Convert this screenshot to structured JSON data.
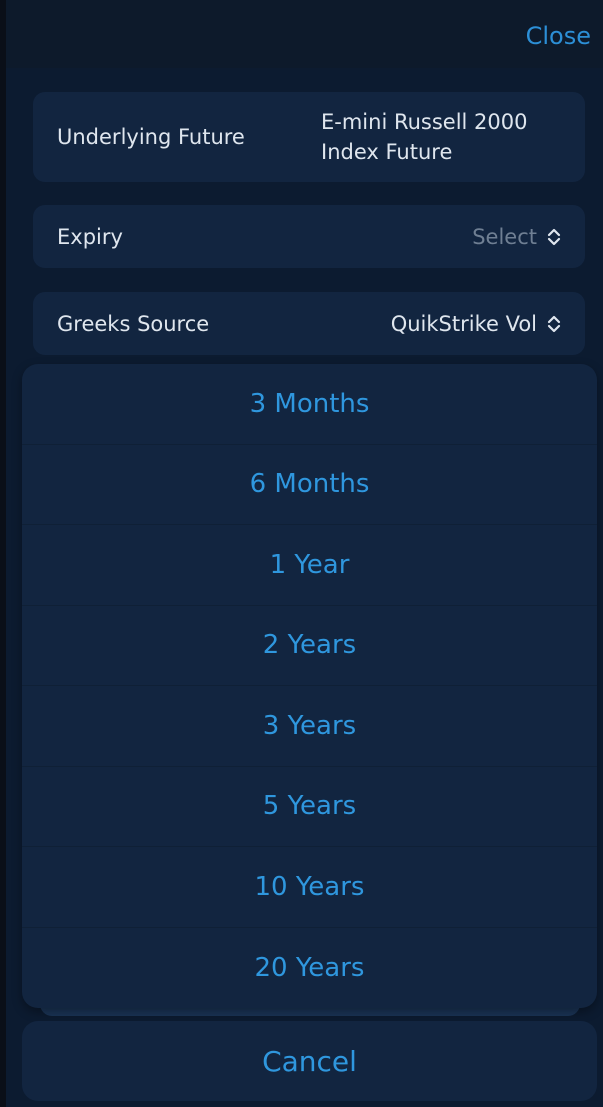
{
  "header": {
    "close_label": "Close"
  },
  "form": {
    "underlying": {
      "label": "Underlying Future",
      "value": "E-mini Russell 2000 Index Future"
    },
    "expiry": {
      "label": "Expiry",
      "value": "Select"
    },
    "greeks": {
      "label": "Greeks Source",
      "value": "QuikStrike Vol"
    }
  },
  "picker": {
    "options": [
      "3 Months",
      "6 Months",
      "1 Year",
      "2 Years",
      "3 Years",
      "5 Years",
      "10 Years",
      "20 Years"
    ]
  },
  "cancel_label": "Cancel",
  "colors": {
    "accent": "#2f97de",
    "card": "#122540",
    "background": "#0c1b30"
  },
  "icons": {
    "select_chevron": "chevron-up-down-icon"
  }
}
